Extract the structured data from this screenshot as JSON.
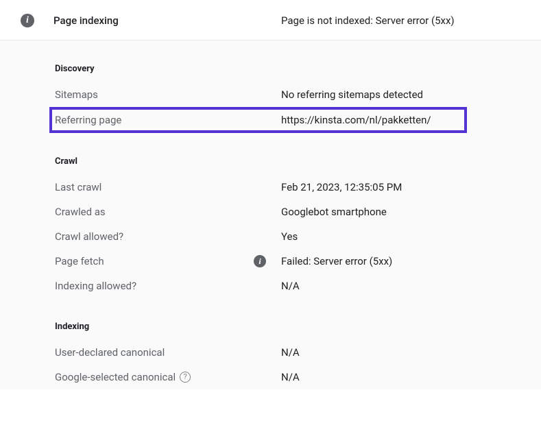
{
  "header": {
    "title": "Page indexing",
    "status": "Page is not indexed: Server error (5xx)"
  },
  "discovery": {
    "heading": "Discovery",
    "sitemaps_label": "Sitemaps",
    "sitemaps_value": "No referring sitemaps detected",
    "referring_label": "Referring page",
    "referring_value": "https://kinsta.com/nl/pakketten/"
  },
  "crawl": {
    "heading": "Crawl",
    "last_crawl_label": "Last crawl",
    "last_crawl_value": "Feb 21, 2023, 12:35:05 PM",
    "crawled_as_label": "Crawled as",
    "crawled_as_value": "Googlebot smartphone",
    "crawl_allowed_label": "Crawl allowed?",
    "crawl_allowed_value": "Yes",
    "page_fetch_label": "Page fetch",
    "page_fetch_value": "Failed: Server error (5xx)",
    "indexing_allowed_label": "Indexing allowed?",
    "indexing_allowed_value": "N/A"
  },
  "indexing": {
    "heading": "Indexing",
    "user_canonical_label": "User-declared canonical",
    "user_canonical_value": "N/A",
    "google_canonical_label": "Google-selected canonical",
    "google_canonical_value": "N/A"
  }
}
